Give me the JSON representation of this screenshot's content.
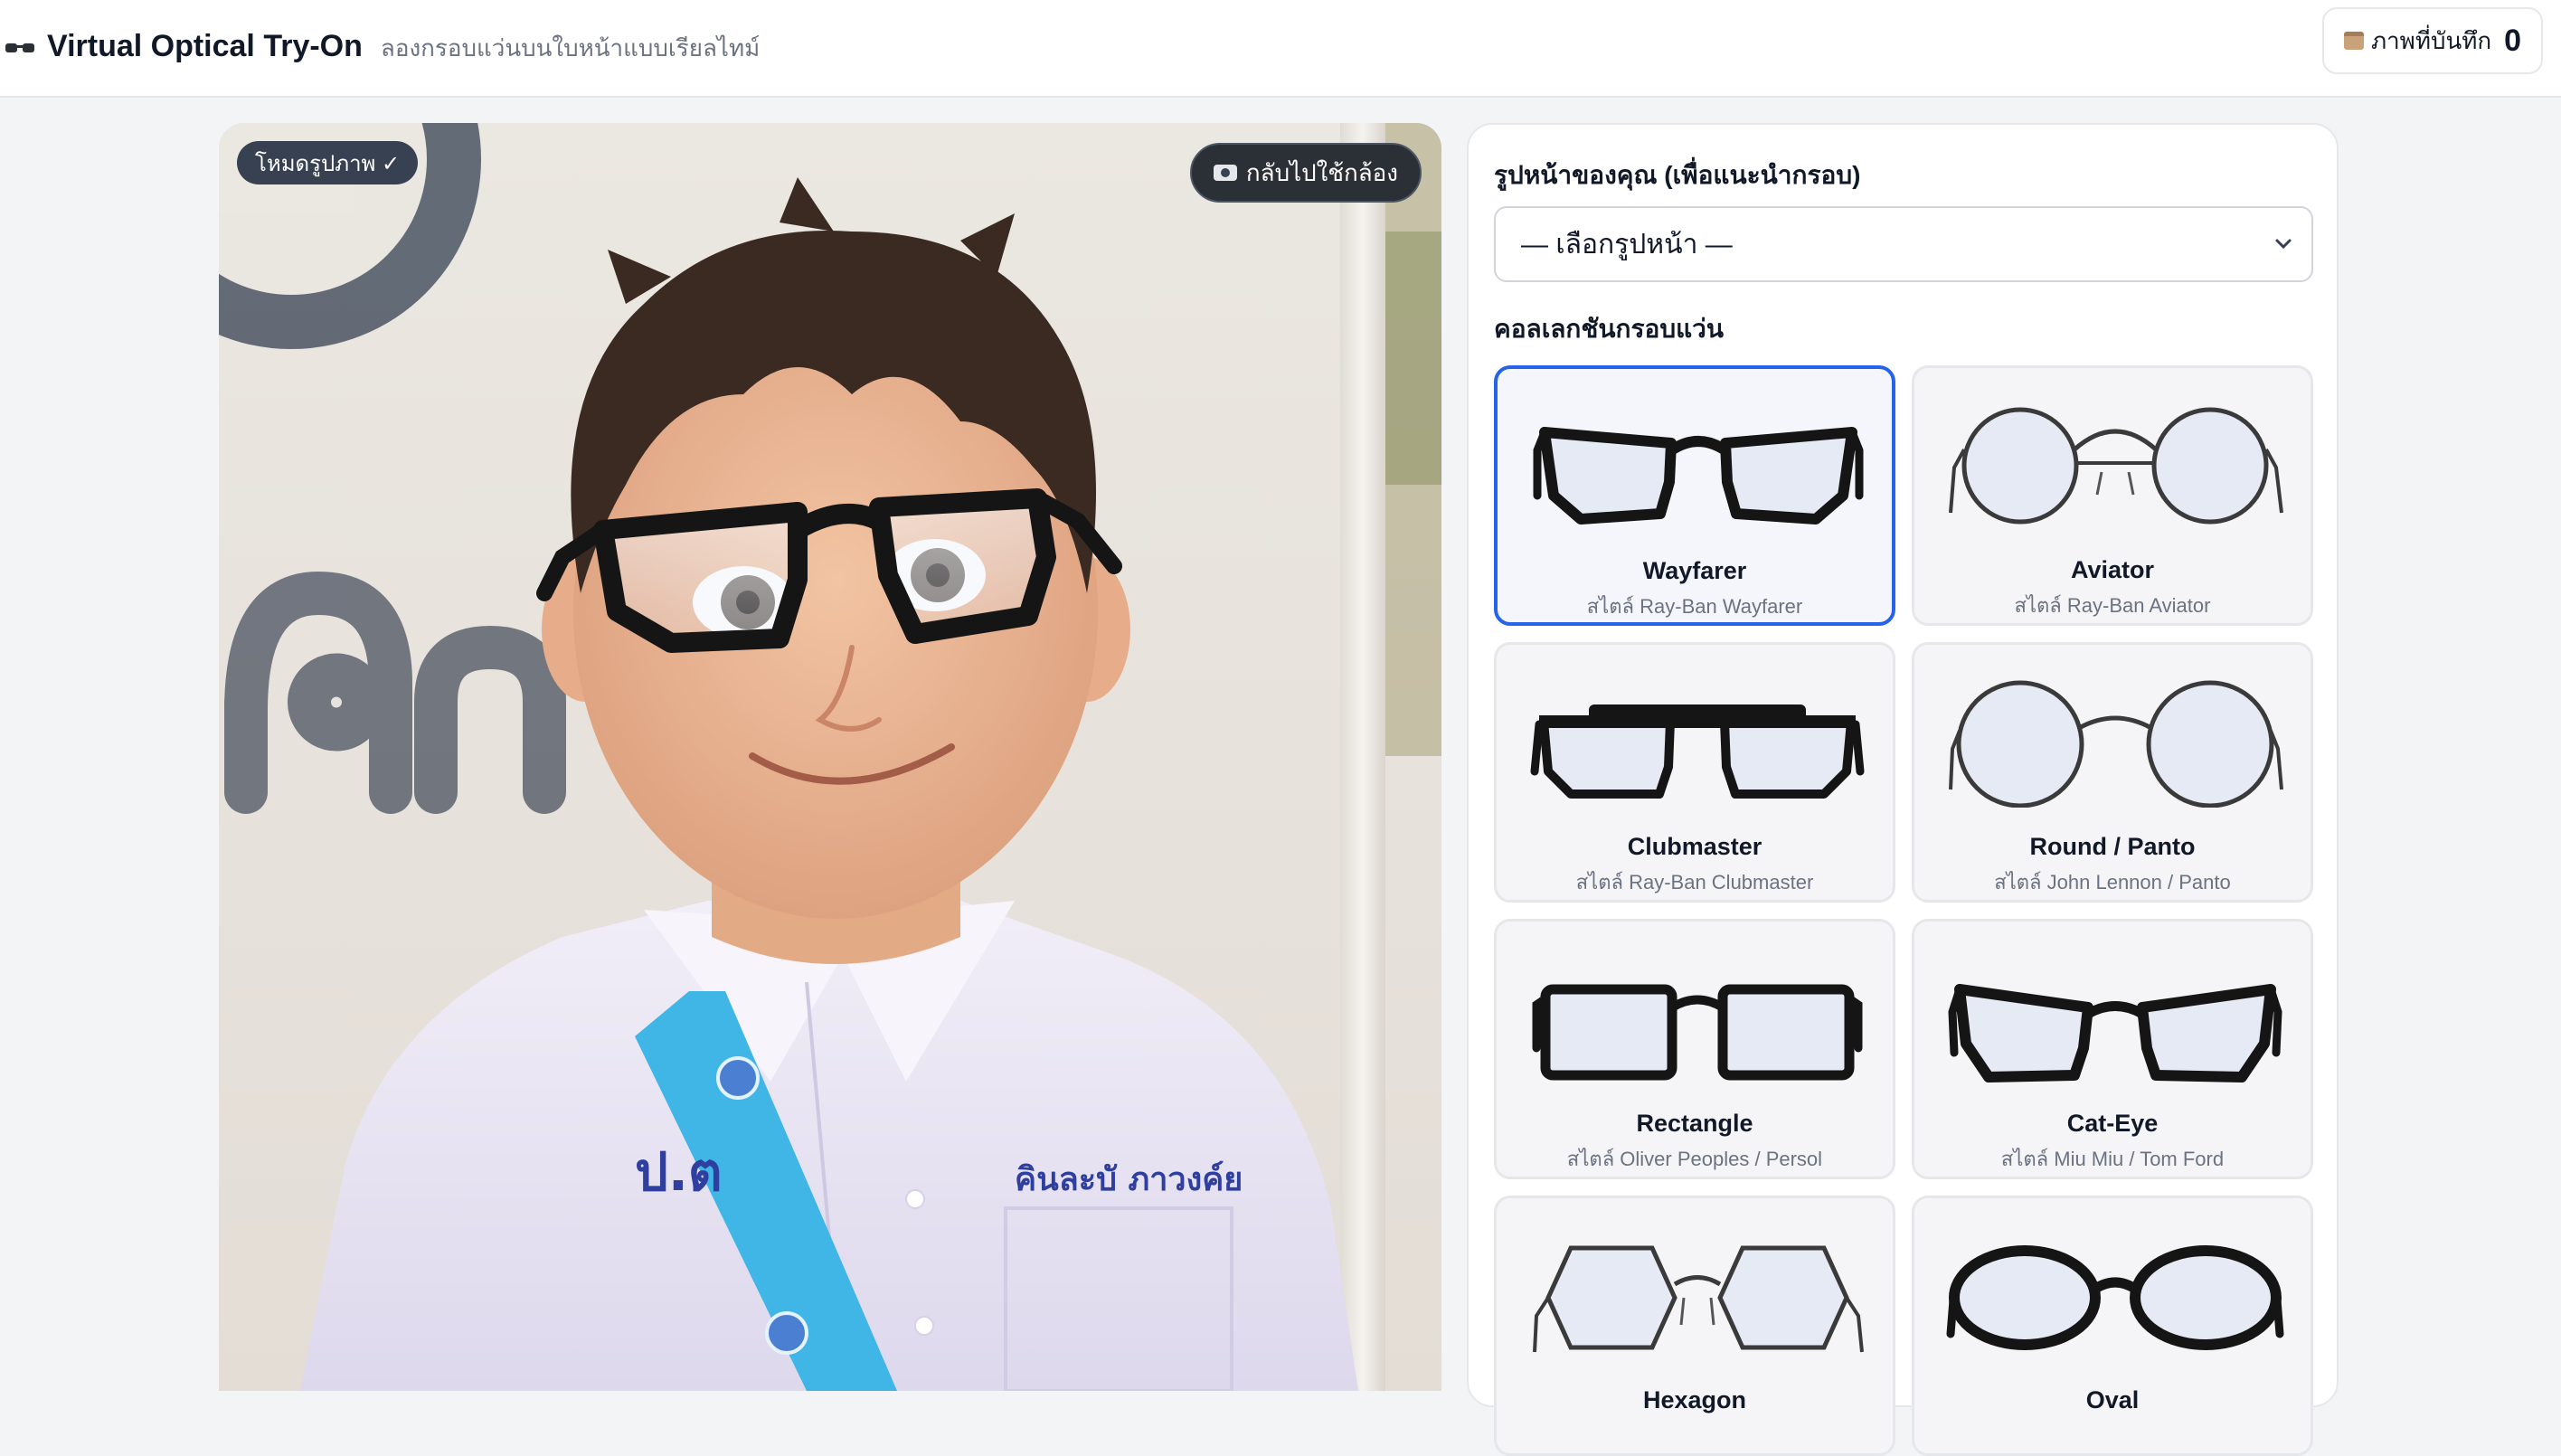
{
  "header": {
    "title": "Virtual Optical Try-On",
    "subtitle": "ลองกรอบแว่นบนใบหน้าแบบเรียลไทม์",
    "saved_label": "ภาพที่บันทึก",
    "saved_count": "0",
    "icons": {
      "brand": "glasses-icon",
      "saved": "box-icon"
    }
  },
  "photo": {
    "mode_badge": "โหมดรูปภาพ ✓",
    "back_camera": "กลับไปใช้กล้อง",
    "background_sign": "ศก",
    "shirt_text_left": "ป.ต",
    "shirt_text_right": "คินละบั ภาวงค์ย"
  },
  "side": {
    "face_shape_label": "รูปหน้าของคุณ (เพื่อแนะนำกรอบ)",
    "face_shape_value": "— เลือกรูปหน้า —",
    "collection_label": "คอลเลกชันกรอบแว่น",
    "frames": [
      {
        "name": "Wayfarer",
        "style": "สไตล์ Ray-Ban Wayfarer",
        "selected": true
      },
      {
        "name": "Aviator",
        "style": "สไตล์ Ray-Ban Aviator",
        "selected": false
      },
      {
        "name": "Clubmaster",
        "style": "สไตล์ Ray-Ban Clubmaster",
        "selected": false
      },
      {
        "name": "Round / Panto",
        "style": "สไตล์ John Lennon / Panto",
        "selected": false
      },
      {
        "name": "Rectangle",
        "style": "สไตล์ Oliver Peoples / Persol",
        "selected": false
      },
      {
        "name": "Cat-Eye",
        "style": "สไตล์ Miu Miu / Tom Ford",
        "selected": false
      },
      {
        "name": "Hexagon",
        "style": "",
        "selected": false
      },
      {
        "name": "Oval",
        "style": "",
        "selected": false
      }
    ]
  },
  "colors": {
    "accent": "#2563eb",
    "badge": "#374151"
  }
}
